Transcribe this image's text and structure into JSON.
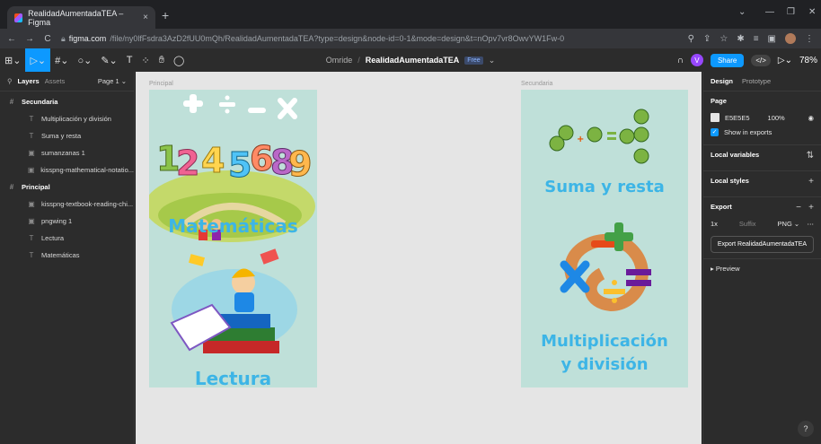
{
  "browser": {
    "tab_title": "RealidadAumentadaTEA – Figma",
    "tab_close": "×",
    "new_tab": "+",
    "url_host": "figma.com",
    "url_path": "/file/ny0lfFsdra3AzD2fUU0mQh/RealidadAumentadaTEA?type=design&node-id=0-1&mode=design&t=nOpv7vr8OwvYW1Fw-0"
  },
  "toolbar": {
    "team": "Omride",
    "separator": "/",
    "file_name": "RealidadAumentadaTEA",
    "badge": "Free",
    "user_initial": "V",
    "share_label": "Share",
    "dev_label": "</>",
    "zoom": "78%"
  },
  "left_panel": {
    "tab_layers": "Layers",
    "tab_assets": "Assets",
    "page": "Page 1",
    "layers": [
      {
        "label": "Secundaria",
        "type": "frame",
        "icon": "#"
      },
      {
        "label": "Multiplicación y división",
        "type": "child",
        "icon": "T"
      },
      {
        "label": "Suma y resta",
        "type": "child",
        "icon": "T"
      },
      {
        "label": "sumanzanas 1",
        "type": "child",
        "icon": "▣"
      },
      {
        "label": "kisspng-mathematical-notatio...",
        "type": "child",
        "icon": "▣"
      },
      {
        "label": "Principal",
        "type": "frame",
        "icon": "#"
      },
      {
        "label": "kisspng-textbook-reading-chi...",
        "type": "child",
        "icon": "▣"
      },
      {
        "label": "pngwing 1",
        "type": "child",
        "icon": "▣"
      },
      {
        "label": "Lectura",
        "type": "child",
        "icon": "T"
      },
      {
        "label": "Matemáticas",
        "type": "child",
        "icon": "T"
      }
    ]
  },
  "canvas": {
    "frame_principal_label": "Principal",
    "frame_secundaria_label": "Secundaria",
    "principal": {
      "title_top": "Matemáticas",
      "title_bottom": "Lectura"
    },
    "secundaria": {
      "title_top": "Suma y resta",
      "title_bottom_1": "Multiplicación",
      "title_bottom_2": "y división"
    }
  },
  "right_panel": {
    "tab_design": "Design",
    "tab_prototype": "Prototype",
    "page_title": "Page",
    "page_color": "E5E5E5",
    "page_opacity": "100%",
    "show_in_exports": "Show in exports",
    "local_variables": "Local variables",
    "local_styles": "Local styles",
    "export_title": "Export",
    "export_scale": "1x",
    "export_suffix": "Suffix",
    "export_format": "PNG",
    "export_button": "Export RealidadAumentadaTEA",
    "preview": "Preview",
    "help": "?"
  }
}
